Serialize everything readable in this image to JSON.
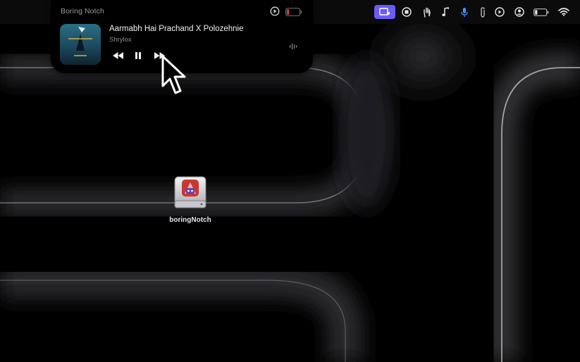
{
  "menubar": {
    "icons": [
      "screen-share-icon",
      "stop-record-icon",
      "hand-icon",
      "music-note-icon",
      "microphone-icon",
      "paperclip-icon",
      "play-circle-icon",
      "user-circle-icon",
      "battery-icon",
      "wifi-icon"
    ],
    "active_color": "#6b5cf6"
  },
  "notch": {
    "app_name": "Boring Notch",
    "track_title": "Aarmabh Hai Prachand X Polozehnie",
    "artist": "Shrylox",
    "battery_color": "#e0423a"
  },
  "desktop": {
    "icon_label": "boringNotch"
  }
}
